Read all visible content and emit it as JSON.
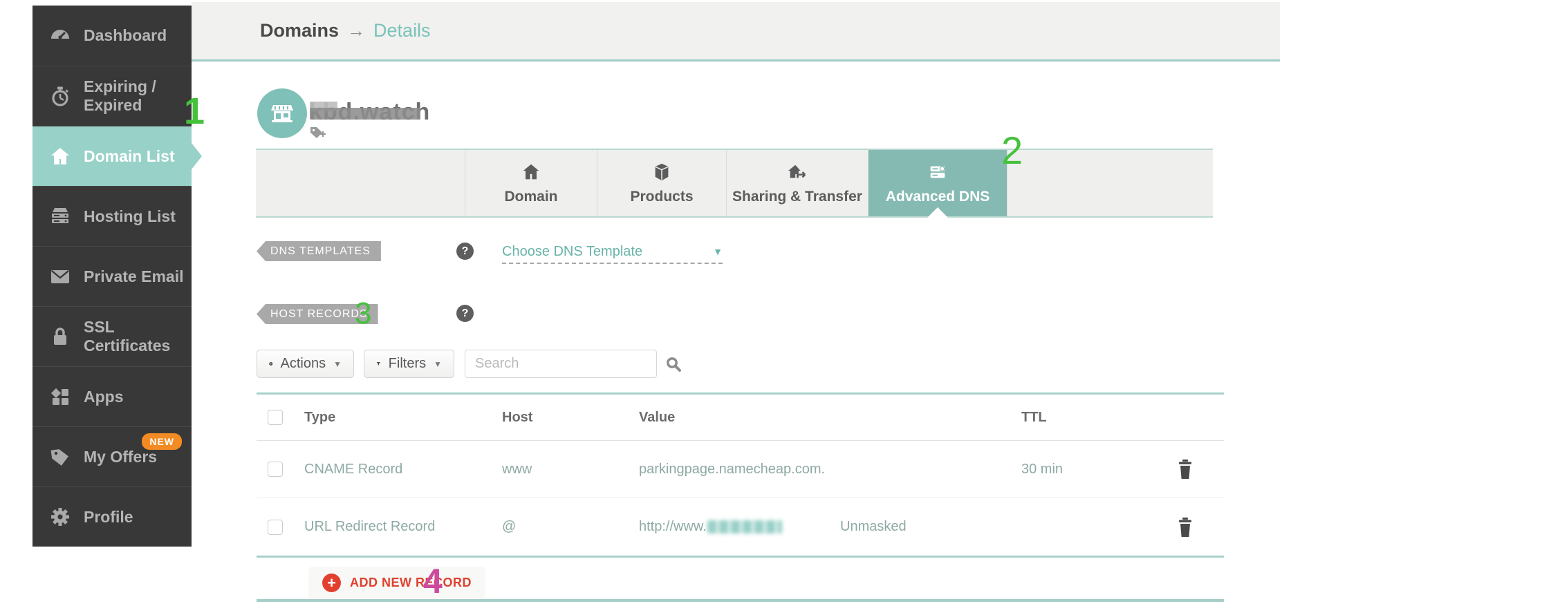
{
  "breadcrumb": {
    "root": "Domains",
    "arrow": "→",
    "current": "Details"
  },
  "sidebar": {
    "items": [
      {
        "label": "Dashboard",
        "icon": "dashboard-icon",
        "active": false
      },
      {
        "label": "Expiring / Expired",
        "icon": "stopwatch-icon",
        "active": false
      },
      {
        "label": "Domain List",
        "icon": "home-icon",
        "active": true
      },
      {
        "label": "Hosting List",
        "icon": "server-icon",
        "active": false
      },
      {
        "label": "Private Email",
        "icon": "envelope-icon",
        "active": false
      },
      {
        "label": "SSL Certificates",
        "icon": "padlock-icon",
        "active": false
      },
      {
        "label": "Apps",
        "icon": "apps-grid-icon",
        "active": false
      },
      {
        "label": "My Offers",
        "icon": "price-tag-icon",
        "active": false,
        "badge": "NEW"
      },
      {
        "label": "Profile",
        "icon": "gear-icon",
        "active": false
      }
    ]
  },
  "domain_header": {
    "name": "kbd.watch",
    "avatar_icon": "storefront-icon",
    "add_tag_icon": "add-tag-icon"
  },
  "tabs": [
    {
      "label": "Domain",
      "icon": "home-icon",
      "active": false
    },
    {
      "label": "Products",
      "icon": "box-icon",
      "active": false
    },
    {
      "label": "Sharing & Transfer",
      "icon": "house-arrow-icon",
      "active": false
    },
    {
      "label": "Advanced DNS",
      "icon": "dns-server-icon",
      "active": true
    }
  ],
  "dns_templates": {
    "badge": "DNS TEMPLATES",
    "help": "?",
    "dropdown_label": "Choose DNS Template",
    "caret": "▼"
  },
  "host_records": {
    "badge": "HOST RECORDS",
    "help": "?"
  },
  "toolbar": {
    "actions_label": "Actions",
    "filters_label": "Filters",
    "caret": "▼",
    "search_placeholder": "Search"
  },
  "table": {
    "headers": [
      "Type",
      "Host",
      "Value",
      "TTL"
    ],
    "rows": [
      {
        "type": "CNAME Record",
        "host": "www",
        "value": "parkingpage.namecheap.com.",
        "ttl": "30 min"
      },
      {
        "type": "URL Redirect Record",
        "host": "@",
        "value_prefix": "http://www.",
        "value_redacted": true,
        "value_mode": "Unmasked",
        "ttl": ""
      }
    ]
  },
  "add_record": {
    "label": "ADD NEW RECORD",
    "plus": "+"
  },
  "annotations": {
    "step1": "1",
    "step2": "2",
    "step3": "3",
    "step4": "4",
    "green_color": "#45c13c",
    "pink_color": "#cd4b9e"
  },
  "colors": {
    "teal_accent_line": "#a5cfc8",
    "teal_tab_active": "#85bab2",
    "teal_sidebar_active": "#98d1c8",
    "teal_link": "#79c3b8",
    "sidebar_bg": "#383838",
    "band_bg": "#f1f1f0",
    "ribbon_gray": "#a9a9a9",
    "record_text": "#8ea9a4",
    "red_action": "#de402e",
    "orange_badge": "#f28b24"
  }
}
